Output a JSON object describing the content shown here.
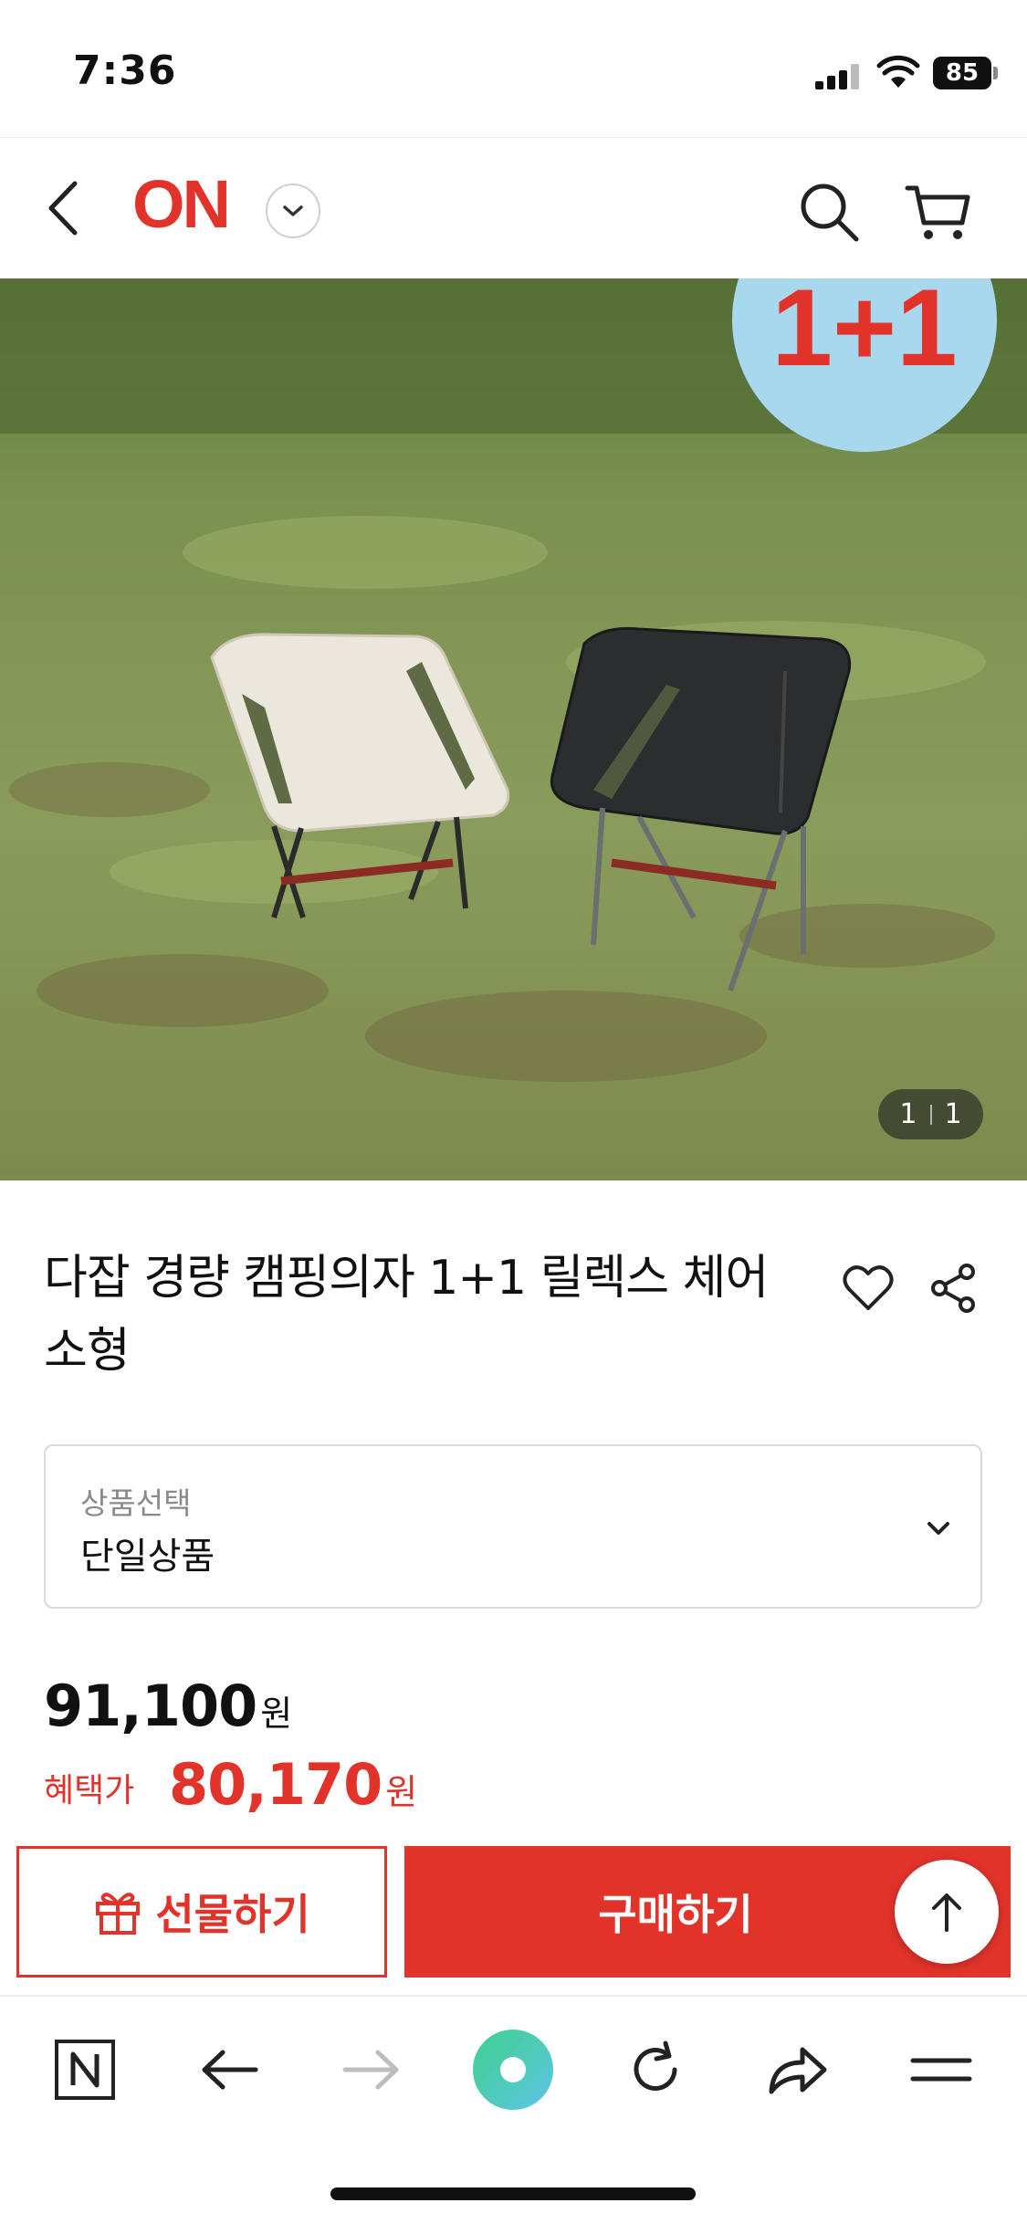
{
  "status_bar": {
    "time": "7:36",
    "battery": "85"
  },
  "header": {
    "logo": "ON"
  },
  "product": {
    "image_badge": "1+1",
    "image_counter": {
      "current": "1",
      "total": "1"
    },
    "title": "다잡 경량 캠핑의자 1+1 릴렉스 체어 소형"
  },
  "option": {
    "label": "상품선택",
    "value": "단일상품"
  },
  "price": {
    "original": "91,100",
    "original_unit": "원",
    "benefit_label": "혜택가",
    "benefit": "80,170",
    "benefit_unit": "원"
  },
  "actions": {
    "gift_label": "선물하기",
    "buy_label": "구매하기"
  },
  "colors": {
    "brand": "#e2332b",
    "browser_accent": "#3fd18b"
  },
  "icons": {
    "header": [
      "back-icon",
      "chevron-down-icon",
      "search-icon",
      "cart-icon"
    ],
    "product": [
      "heart-icon",
      "share-icon"
    ],
    "browser": [
      "naver-n-icon",
      "back-arrow-icon",
      "forward-arrow-icon",
      "green-dot-icon",
      "reload-icon",
      "share-forward-icon",
      "menu-icon"
    ]
  }
}
